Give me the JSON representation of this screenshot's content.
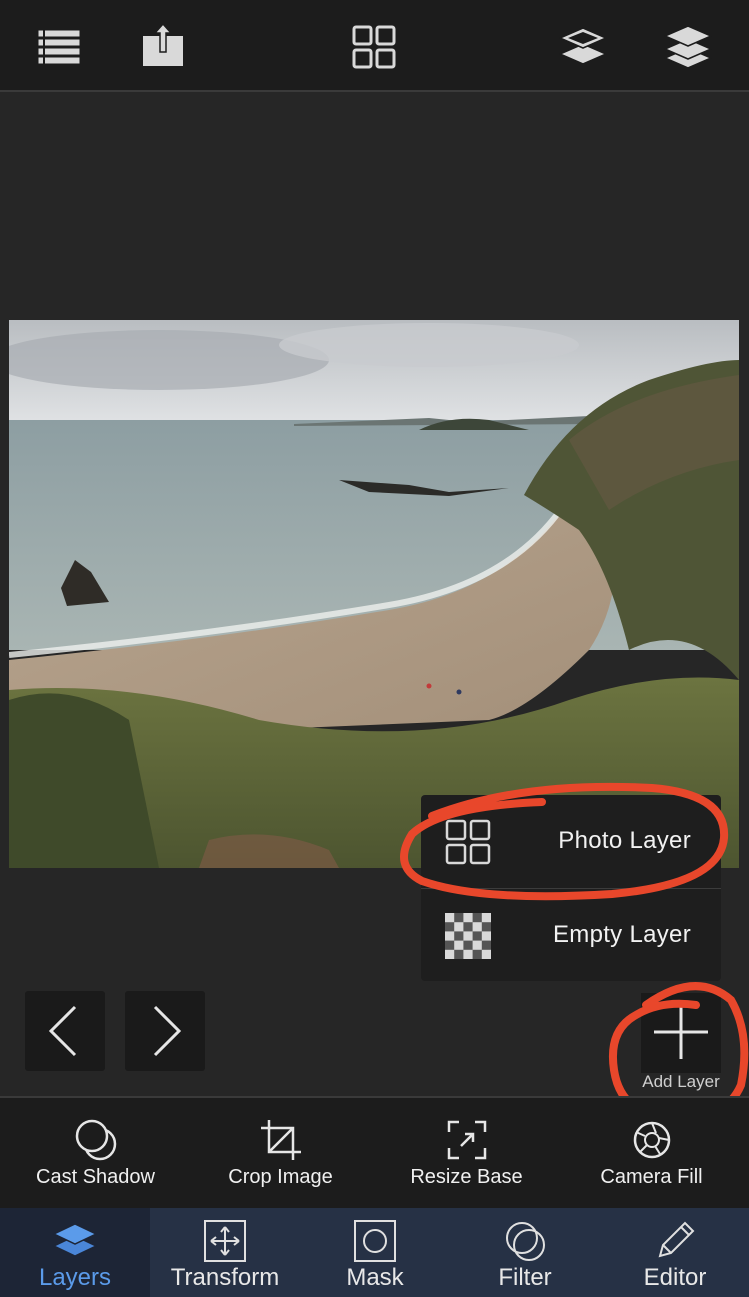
{
  "canvas": {
    "image": "coastal-beach-photo"
  },
  "add_menu": {
    "items": [
      {
        "label": "Photo Layer",
        "icon": "grid-icon"
      },
      {
        "label": "Empty Layer",
        "icon": "checkerboard-icon"
      }
    ]
  },
  "controls": {
    "add_layer_label": "Add Layer"
  },
  "toolbar": {
    "items": [
      {
        "label": "Cast Shadow",
        "icon": "shadow-icon"
      },
      {
        "label": "Crop Image",
        "icon": "crop-icon"
      },
      {
        "label": "Resize Base",
        "icon": "resize-icon"
      },
      {
        "label": "Camera Fill",
        "icon": "camera-icon"
      }
    ]
  },
  "tabs": {
    "items": [
      {
        "label": "Layers",
        "icon": "layers-icon",
        "active": true
      },
      {
        "label": "Transform",
        "icon": "transform-icon"
      },
      {
        "label": "Mask",
        "icon": "mask-icon"
      },
      {
        "label": "Filter",
        "icon": "filter-icon"
      },
      {
        "label": "Editor",
        "icon": "pencil-icon"
      }
    ]
  },
  "colors": {
    "accent": "#5b9bea",
    "annotation": "#e8472b",
    "tabbar": "#263145"
  }
}
